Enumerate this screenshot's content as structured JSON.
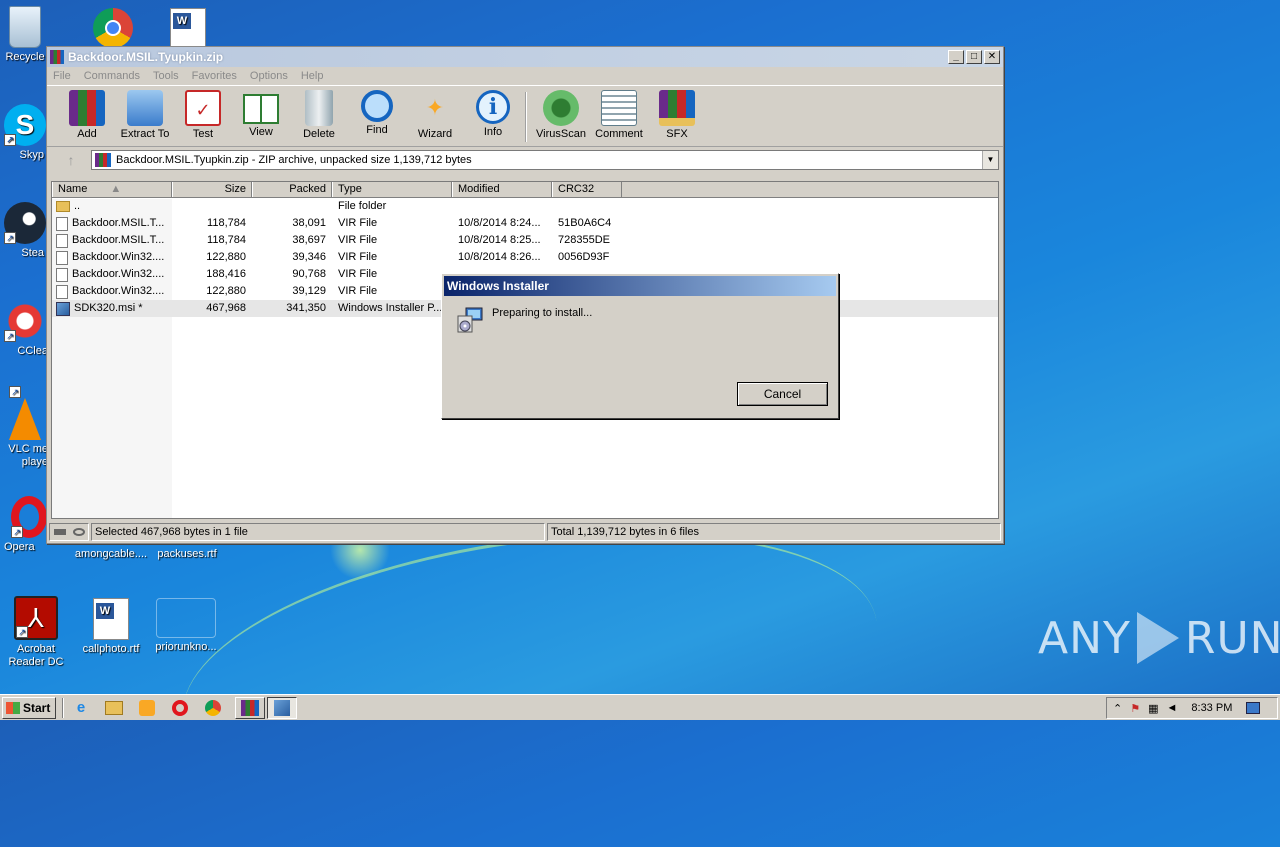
{
  "desktop": {
    "icons": [
      {
        "label": "Recycle",
        "name": "recycle-bin"
      },
      {
        "label": "Skyp",
        "name": "skype"
      },
      {
        "label": "Stea",
        "name": "steam"
      },
      {
        "label": "CClea",
        "name": "ccleaner"
      },
      {
        "label": "VLC me\nplaye",
        "name": "vlc"
      },
      {
        "label": "Opera",
        "name": "opera"
      },
      {
        "label": "amongcable....",
        "name": "amongcable"
      },
      {
        "label": "packuses.rtf",
        "name": "packuses"
      },
      {
        "label": "Acrobat Reader DC",
        "name": "acrobat"
      },
      {
        "label": "callphoto.rtf",
        "name": "callphoto"
      },
      {
        "label": "priorunkno...",
        "name": "priorunkno"
      }
    ],
    "vlc_line1": "VLC me",
    "vlc_line2": "playe",
    "acrobat_line1": "Acrobat",
    "acrobat_line2": "Reader DC"
  },
  "window": {
    "title": "Backdoor.MSIL.Tyupkin.zip",
    "menu": [
      "File",
      "Commands",
      "Tools",
      "Favorites",
      "Options",
      "Help"
    ],
    "toolbar": [
      "Add",
      "Extract To",
      "Test",
      "View",
      "Delete",
      "Find",
      "Wizard",
      "Info",
      "VirusScan",
      "Comment",
      "SFX"
    ],
    "address": "Backdoor.MSIL.Tyupkin.zip - ZIP archive, unpacked size 1,139,712 bytes",
    "columns": [
      "Name",
      "Size",
      "Packed",
      "Type",
      "Modified",
      "CRC32"
    ],
    "rows": [
      {
        "name": "..",
        "size": "",
        "packed": "",
        "type": "File folder",
        "modified": "",
        "crc": "",
        "icon": "folder"
      },
      {
        "name": "Backdoor.MSIL.T...",
        "size": "118,784",
        "packed": "38,091",
        "type": "VIR File",
        "modified": "10/8/2014 8:24...",
        "crc": "51B0A6C4",
        "icon": "file"
      },
      {
        "name": "Backdoor.MSIL.T...",
        "size": "118,784",
        "packed": "38,697",
        "type": "VIR File",
        "modified": "10/8/2014 8:25...",
        "crc": "728355DE",
        "icon": "file"
      },
      {
        "name": "Backdoor.Win32....",
        "size": "122,880",
        "packed": "39,346",
        "type": "VIR File",
        "modified": "10/8/2014 8:26...",
        "crc": "0056D93F",
        "icon": "file"
      },
      {
        "name": "Backdoor.Win32....",
        "size": "188,416",
        "packed": "90,768",
        "type": "VIR File",
        "modified": "",
        "crc": "",
        "icon": "file"
      },
      {
        "name": "Backdoor.Win32....",
        "size": "122,880",
        "packed": "39,129",
        "type": "VIR File",
        "modified": "",
        "crc": "",
        "icon": "file"
      },
      {
        "name": "SDK320.msi *",
        "size": "467,968",
        "packed": "341,350",
        "type": "Windows Installer P...",
        "modified": "",
        "crc": "",
        "icon": "msi"
      }
    ],
    "status_left": "Selected 467,968 bytes in 1 file",
    "status_right": "Total 1,139,712 bytes in 6 files"
  },
  "dialog": {
    "title": "Windows Installer",
    "message": "Preparing to install...",
    "cancel": "Cancel"
  },
  "taskbar": {
    "start": "Start",
    "clock": "8:33 PM"
  },
  "watermark": "ANY RUN"
}
